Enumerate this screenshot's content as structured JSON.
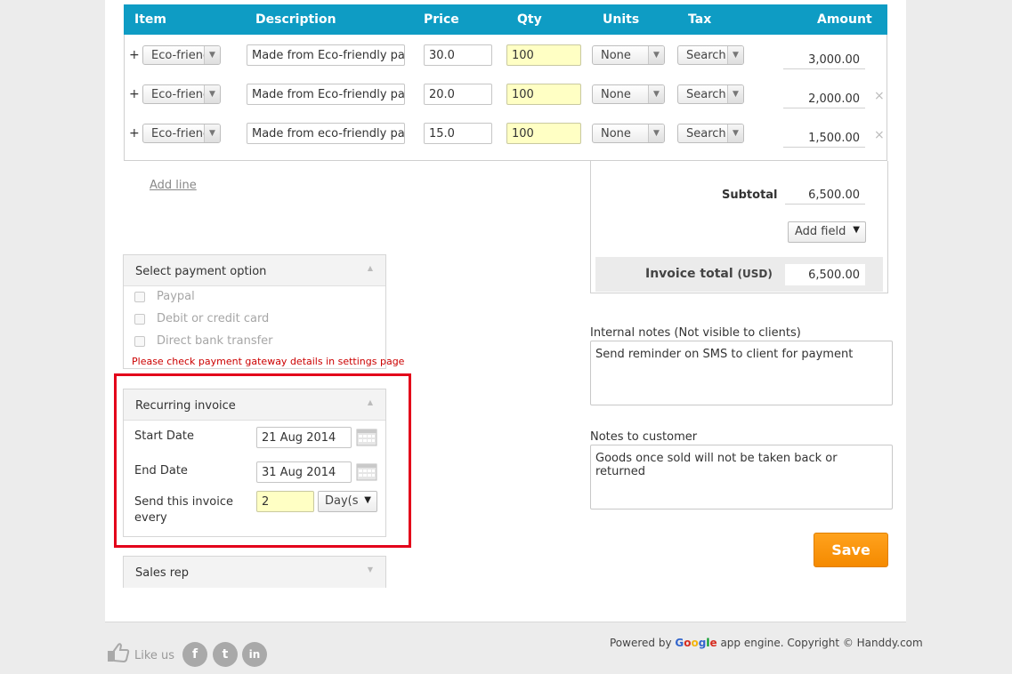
{
  "table": {
    "headers": {
      "item": "Item",
      "description": "Description",
      "price": "Price",
      "qty": "Qty",
      "units": "Units",
      "tax": "Tax",
      "amount": "Amount"
    },
    "rows": [
      {
        "item": "Eco-friend",
        "description": "Made from Eco-friendly paper",
        "price": "30.0",
        "qty": "100",
        "units": "None",
        "tax": "Search",
        "amount": "3,000.00"
      },
      {
        "item": "Eco-friend",
        "description": "Made from Eco-friendly paper",
        "price": "20.0",
        "qty": "100",
        "units": "None",
        "tax": "Search",
        "amount": "2,000.00"
      },
      {
        "item": "Eco-friend",
        "description": "Made from eco-friendly paper",
        "price": "15.0",
        "qty": "100",
        "units": "None",
        "tax": "Search",
        "amount": "1,500.00"
      }
    ],
    "add_row_symbol": "+",
    "remove_symbol": "×"
  },
  "add_line_label": "Add line",
  "totals": {
    "subtotal_label": "Subtotal",
    "subtotal_value": "6,500.00",
    "add_field_label": "Add field",
    "invoice_total_label": "Invoice total",
    "currency": "(USD)",
    "invoice_total_value": "6,500.00"
  },
  "payment": {
    "title": "Select payment option",
    "options": [
      "Paypal",
      "Debit or credit card",
      "Direct bank transfer"
    ],
    "warning": "Please check payment gateway details in settings page"
  },
  "recurring": {
    "title": "Recurring invoice",
    "start_label": "Start Date",
    "start_value": "21 Aug 2014",
    "end_label": "End Date",
    "end_value": "31 Aug 2014",
    "every_label": "Send this invoice every",
    "every_value": "2",
    "every_unit": "Day(s"
  },
  "sales_rep": {
    "title": "Sales rep"
  },
  "internal_notes": {
    "label": "Internal notes (Not visible to clients)",
    "value": "Send reminder on SMS to client for payment"
  },
  "customer_notes": {
    "label": "Notes to customer",
    "value": "Goods once sold will not be taken back or returned"
  },
  "save_label": "Save",
  "footer": {
    "like_us": "Like us",
    "powered_by": "Powered by",
    "google_letters": [
      "G",
      "o",
      "o",
      "g",
      "l",
      "e"
    ],
    "copyright": "app engine. Copyright © Handdy.com"
  },
  "colors": {
    "header_blue": "#0e9cc4",
    "save_orange": "#f58a00",
    "highlight_red": "#e3001a",
    "qty_yellow": "#ffffc4",
    "warning_red": "#cc0000"
  }
}
